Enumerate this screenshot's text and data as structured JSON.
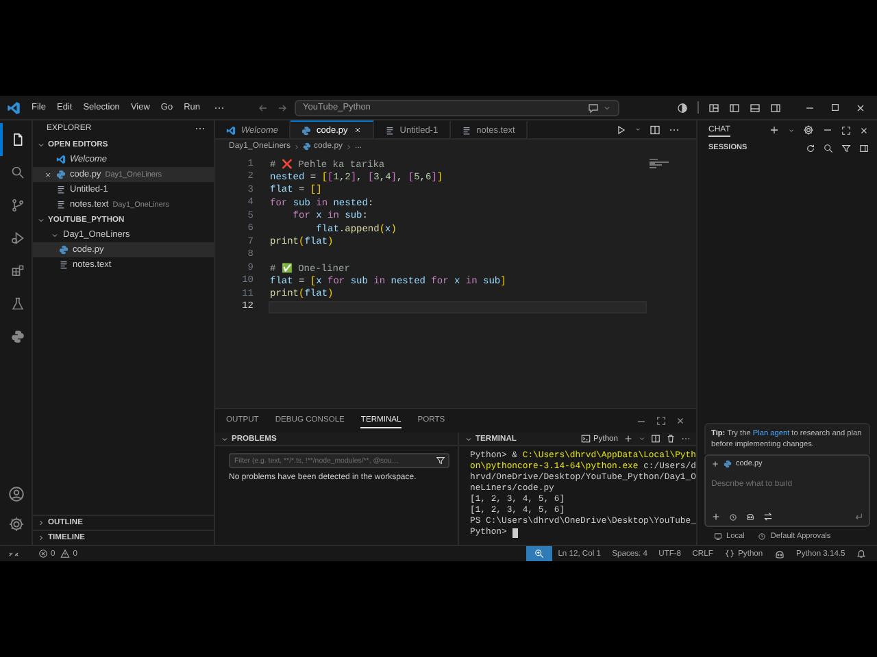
{
  "window": {
    "title": "YouTube_Python"
  },
  "menu": [
    "File",
    "Edit",
    "Selection",
    "View",
    "Go",
    "Run"
  ],
  "activity_bar": {
    "top": [
      {
        "kind": "explorer",
        "selected": true
      },
      {
        "kind": "search",
        "selected": false
      },
      {
        "kind": "source_control",
        "selected": false
      },
      {
        "kind": "run_debug",
        "selected": false
      },
      {
        "kind": "extensions",
        "selected": false
      },
      {
        "kind": "testing",
        "selected": false
      },
      {
        "kind": "python",
        "selected": false
      }
    ],
    "bottom": [
      {
        "kind": "accounts"
      },
      {
        "kind": "settings"
      }
    ]
  },
  "sidebar": {
    "title": "EXPLORER",
    "open_editors": {
      "title": "OPEN EDITORS",
      "expanded": true,
      "items": [
        {
          "name": "Welcome",
          "kind": "welcome",
          "preview": true,
          "selected": false
        },
        {
          "name": "code.py",
          "kind": "python",
          "preview": false,
          "selected": true,
          "detail": "Day1_OneLiners"
        },
        {
          "name": "Untitled-1",
          "kind": "text",
          "preview": false,
          "selected": false
        },
        {
          "name": "notes.text",
          "kind": "text",
          "preview": false,
          "selected": false,
          "detail": "Day1_OneLiners"
        }
      ]
    },
    "workspace": {
      "title": "YOUTUBE_PYTHON",
      "expanded": true,
      "tree": [
        {
          "name": "Day1_OneLiners",
          "kind": "folder",
          "expanded": true,
          "selected": false,
          "children": [
            {
              "name": "code.py",
              "kind": "python",
              "selected": true
            },
            {
              "name": "notes.text",
              "kind": "text",
              "selected": false
            }
          ]
        }
      ]
    },
    "collapsed_sections": [
      {
        "title": "OUTLINE",
        "expanded": false
      },
      {
        "title": "TIMELINE",
        "expanded": false
      }
    ]
  },
  "editor": {
    "tabs": [
      {
        "label": "Welcome",
        "kind": "welcome",
        "preview": true,
        "selected": false
      },
      {
        "label": "code.py",
        "kind": "python",
        "preview": false,
        "selected": true
      },
      {
        "label": "Untitled-1",
        "kind": "text",
        "preview": false,
        "selected": false
      },
      {
        "label": "notes.text",
        "kind": "text",
        "preview": false,
        "selected": false
      }
    ],
    "breadcrumb": [
      "Day1_OneLiners",
      "code.py",
      "..."
    ],
    "lines": [
      {
        "number": "1",
        "current": false,
        "tokens": [
          {
            "kind": "cm",
            "text": "# "
          },
          {
            "kind": "emoji",
            "text": "❌"
          },
          {
            "kind": "cm",
            "text": " Pehle ka tarika"
          }
        ]
      },
      {
        "number": "2",
        "current": false,
        "tokens": [
          {
            "kind": "var",
            "text": "nested"
          },
          {
            "kind": "op",
            "text": " = "
          },
          {
            "kind": "br1",
            "text": "["
          },
          {
            "kind": "br2",
            "text": "["
          },
          {
            "kind": "num",
            "text": "1"
          },
          {
            "kind": "op",
            "text": ","
          },
          {
            "kind": "num",
            "text": "2"
          },
          {
            "kind": "br2",
            "text": "]"
          },
          {
            "kind": "op",
            "text": ", "
          },
          {
            "kind": "br2",
            "text": "["
          },
          {
            "kind": "num",
            "text": "3"
          },
          {
            "kind": "op",
            "text": ","
          },
          {
            "kind": "num",
            "text": "4"
          },
          {
            "kind": "br2",
            "text": "]"
          },
          {
            "kind": "op",
            "text": ", "
          },
          {
            "kind": "br2",
            "text": "["
          },
          {
            "kind": "num",
            "text": "5"
          },
          {
            "kind": "op",
            "text": ","
          },
          {
            "kind": "num",
            "text": "6"
          },
          {
            "kind": "br2",
            "text": "]"
          },
          {
            "kind": "br1",
            "text": "]"
          }
        ]
      },
      {
        "number": "3",
        "current": false,
        "tokens": [
          {
            "kind": "var",
            "text": "flat"
          },
          {
            "kind": "op",
            "text": " = "
          },
          {
            "kind": "br1",
            "text": "[]"
          }
        ]
      },
      {
        "number": "4",
        "current": false,
        "tokens": [
          {
            "kind": "kw",
            "text": "for "
          },
          {
            "kind": "var",
            "text": "sub "
          },
          {
            "kind": "kw",
            "text": "in "
          },
          {
            "kind": "var",
            "text": "nested"
          },
          {
            "kind": "op",
            "text": ":"
          }
        ]
      },
      {
        "number": "5",
        "current": false,
        "tokens": [
          {
            "kind": "kw",
            "text": "    for "
          },
          {
            "kind": "var",
            "text": "x "
          },
          {
            "kind": "kw",
            "text": "in "
          },
          {
            "kind": "var",
            "text": "sub"
          },
          {
            "kind": "op",
            "text": ":"
          }
        ]
      },
      {
        "number": "6",
        "current": false,
        "tokens": [
          {
            "kind": "var",
            "text": "        flat"
          },
          {
            "kind": "op",
            "text": "."
          },
          {
            "kind": "fn",
            "text": "append"
          },
          {
            "kind": "br1",
            "text": "("
          },
          {
            "kind": "var",
            "text": "x"
          },
          {
            "kind": "br1",
            "text": ")"
          }
        ]
      },
      {
        "number": "7",
        "current": false,
        "tokens": [
          {
            "kind": "fn",
            "text": "print"
          },
          {
            "kind": "br1",
            "text": "("
          },
          {
            "kind": "var",
            "text": "flat"
          },
          {
            "kind": "br1",
            "text": ")"
          }
        ]
      },
      {
        "number": "8",
        "current": false
      },
      {
        "number": "9",
        "current": false,
        "tokens": [
          {
            "kind": "cm",
            "text": "# "
          },
          {
            "kind": "emoji",
            "text": "✅"
          },
          {
            "kind": "cm",
            "text": " One-liner"
          }
        ]
      },
      {
        "number": "10",
        "current": false,
        "tokens": [
          {
            "kind": "var",
            "text": "flat"
          },
          {
            "kind": "op",
            "text": " = "
          },
          {
            "kind": "br1",
            "text": "["
          },
          {
            "kind": "var",
            "text": "x "
          },
          {
            "kind": "kw",
            "text": "for "
          },
          {
            "kind": "var",
            "text": "sub "
          },
          {
            "kind": "kw",
            "text": "in "
          },
          {
            "kind": "var",
            "text": "nested "
          },
          {
            "kind": "kw",
            "text": "for "
          },
          {
            "kind": "var",
            "text": "x "
          },
          {
            "kind": "kw",
            "text": "in "
          },
          {
            "kind": "var",
            "text": "sub"
          },
          {
            "kind": "br1",
            "text": "]"
          }
        ]
      },
      {
        "number": "11",
        "current": false,
        "tokens": [
          {
            "kind": "fn",
            "text": "print"
          },
          {
            "kind": "br1",
            "text": "("
          },
          {
            "kind": "var",
            "text": "flat"
          },
          {
            "kind": "br1",
            "text": ")"
          }
        ]
      },
      {
        "number": "12",
        "current": true
      }
    ]
  },
  "panel": {
    "tabs": [
      {
        "label": "OUTPUT",
        "selected": false
      },
      {
        "label": "DEBUG CONSOLE",
        "selected": false
      },
      {
        "label": "TERMINAL",
        "selected": true
      },
      {
        "label": "PORTS",
        "selected": false
      }
    ],
    "problems": {
      "title": "PROBLEMS",
      "expanded": true,
      "filter_placeholder": "Filter (e.g. text, **/*.ts, !**/node_modules/**, @sou…",
      "message": "No problems have been detected in the workspace."
    },
    "terminal": {
      "title": "TERMINAL",
      "expanded": true,
      "shell": "Python",
      "lines": [
        {
          "cursor": false,
          "tokens": [
            {
              "kind": "text",
              "text": "Python> & "
            },
            {
              "kind": "path",
              "text": "C:\\Users\\dhrvd\\AppData\\Local\\Pyth"
            }
          ]
        },
        {
          "cursor": false,
          "tokens": [
            {
              "kind": "path",
              "text": "on\\pythoncore-3.14-64\\python.exe"
            },
            {
              "kind": "text",
              "text": " c:/Users/d"
            }
          ]
        },
        {
          "cursor": false,
          "tokens": [
            {
              "kind": "text",
              "text": "hrvd/OneDrive/Desktop/YouTube_Python/Day1_O"
            }
          ]
        },
        {
          "cursor": false,
          "tokens": [
            {
              "kind": "text",
              "text": "neLiners/code.py"
            }
          ]
        },
        {
          "cursor": false,
          "tokens": [
            {
              "kind": "text",
              "text": "[1, 2, 3, 4, 5, 6]"
            }
          ]
        },
        {
          "cursor": false,
          "tokens": [
            {
              "kind": "text",
              "text": "[1, 2, 3, 4, 5, 6]"
            }
          ]
        },
        {
          "cursor": false,
          "tokens": [
            {
              "kind": "text",
              "text": "PS C:\\Users\\dhrvd\\OneDrive\\Desktop\\YouTube_"
            }
          ]
        },
        {
          "cursor": true,
          "tokens": [
            {
              "kind": "text",
              "text": "Python>"
            }
          ]
        }
      ]
    }
  },
  "chat": {
    "title": "CHAT",
    "sessions_title": "SESSIONS",
    "tip": {
      "before": "**Tip:** Try the",
      "link": "Plan agent",
      "after": "to research and plan before implementing changes."
    },
    "attachments": [
      {
        "name": "code.py",
        "kind": "python"
      }
    ],
    "placeholder": "Describe what to build",
    "footer": [
      {
        "label": "Local",
        "kind": "local"
      },
      {
        "label": "Default Approvals",
        "kind": "approvals"
      }
    ]
  },
  "status_bar": {
    "left": [
      {
        "kind": "remote"
      },
      {
        "kind": "errors",
        "text": "0"
      },
      {
        "kind": "warnings",
        "text": "0"
      }
    ],
    "right": [
      {
        "kind": "zoom"
      },
      {
        "kind": "text",
        "text": "Ln 12, Col 1"
      },
      {
        "kind": "text",
        "text": "Spaces: 4"
      },
      {
        "kind": "text",
        "text": "UTF-8"
      },
      {
        "kind": "text",
        "text": "CRLF"
      },
      {
        "kind": "language",
        "text": "Python"
      },
      {
        "kind": "copilot"
      },
      {
        "kind": "text",
        "text": "Python 3.14.5"
      },
      {
        "kind": "bell"
      }
    ]
  }
}
